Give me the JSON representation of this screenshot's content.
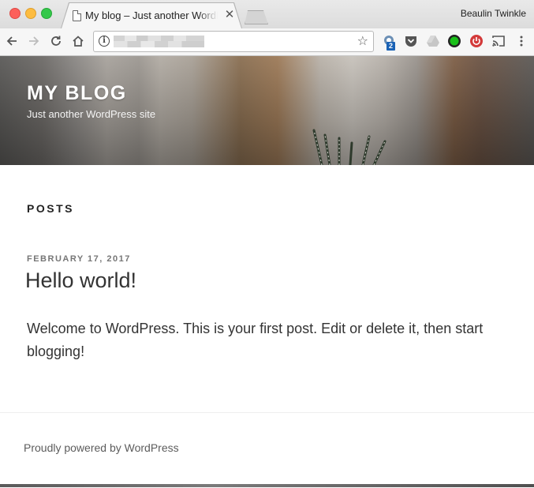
{
  "browser": {
    "tab": {
      "title": "My blog – Just another WordPress site",
      "close_glyph": "✕"
    },
    "profile_name": "Beaulin Twinkle",
    "toolbar": {
      "back_icon": "arrow-left-icon",
      "forward_icon": "arrow-right-icon",
      "reload_icon": "reload-icon",
      "home_icon": "home-icon",
      "info_icon": "info-icon",
      "bookmark_icon": "star-icon"
    },
    "extensions": [
      {
        "name": "extension-badge-icon",
        "badge": "2"
      },
      {
        "name": "pocket-icon"
      },
      {
        "name": "drive-icon"
      },
      {
        "name": "green-dot-icon"
      },
      {
        "name": "power-icon"
      },
      {
        "name": "cast-icon"
      },
      {
        "name": "menu-icon"
      }
    ]
  },
  "site": {
    "title": "My blog",
    "description": "Just another WordPress site"
  },
  "content": {
    "heading": "Posts",
    "post": {
      "date": "February 17, 2017",
      "title": "Hello world!",
      "body": "Welcome to WordPress. This is your first post. Edit or delete it, then start blogging!"
    }
  },
  "footer": {
    "credit": "Proudly powered by WordPress"
  }
}
